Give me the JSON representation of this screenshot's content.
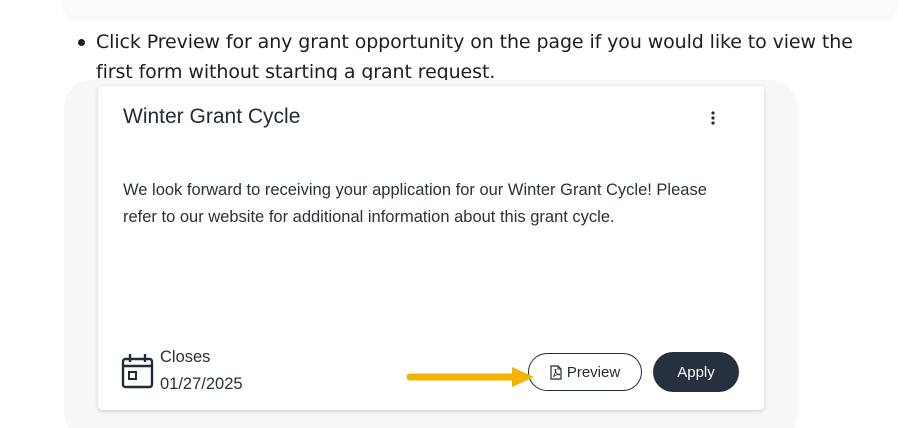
{
  "instruction": {
    "text": "Click Preview for any grant opportunity on the page if you would like to view the first form without starting a grant request."
  },
  "card": {
    "title": "Winter Grant Cycle",
    "description": "We look forward to receiving your application for our Winter Grant Cycle! Please refer to our website for additional information about this grant cycle.",
    "closes_label": "Closes",
    "closes_date": "01/27/2025",
    "preview_label": "Preview",
    "apply_label": "Apply",
    "more_icon": "vertical-ellipsis-icon",
    "calendar_icon": "calendar-icon",
    "pdf_icon": "pdf-file-icon"
  },
  "annotation": {
    "arrow_icon": "arrow-right-icon",
    "arrow_color": "#F2B400"
  },
  "colors": {
    "primary_dark": "#26303F",
    "text": "#2A313C",
    "card_background": "#FFFFFF"
  }
}
